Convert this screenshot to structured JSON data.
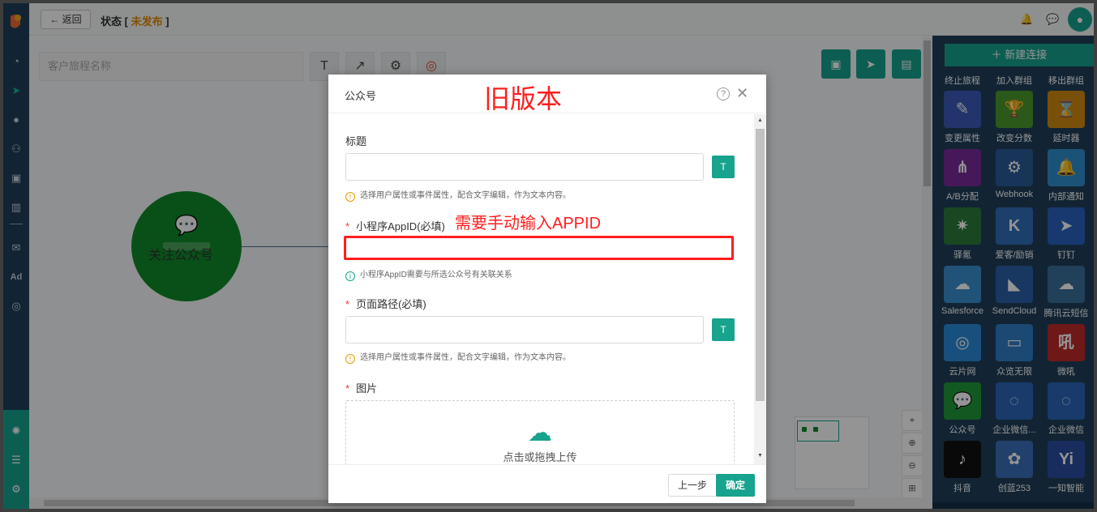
{
  "header": {
    "back_label": "返回",
    "status_prefix": "状态 [",
    "status_value": "未发布",
    "status_suffix": "]"
  },
  "canvas": {
    "name_placeholder": "客户旅程名称",
    "node_label": "关注公众号"
  },
  "right_panel": {
    "new_connection_label": "新建连接",
    "top_captions": [
      "终止旅程",
      "加入群组",
      "移出群组"
    ],
    "tiles": [
      {
        "label": "变更属性",
        "icon": "edit-icon",
        "color": "#3a5bb8",
        "glyph": "✎"
      },
      {
        "label": "改变分数",
        "icon": "trophy-icon",
        "color": "#4a9a2e",
        "glyph": "🏆"
      },
      {
        "label": "延时器",
        "icon": "hourglass-icon",
        "color": "#d08a10",
        "glyph": "⌛"
      },
      {
        "label": "A/B分配",
        "icon": "ab-split-icon",
        "color": "#7a2a9a",
        "glyph": "⋔"
      },
      {
        "label": "Webhook",
        "icon": "webhook-icon",
        "color": "#2a5b9a",
        "glyph": "⚙"
      },
      {
        "label": "内部通知",
        "icon": "bell-icon",
        "color": "#2f8fcf",
        "glyph": "🔔"
      },
      {
        "label": "驿氪",
        "icon": "spider-icon",
        "color": "#2a7a3a",
        "glyph": "✷"
      },
      {
        "label": "爱客/励销",
        "icon": "k-logo-icon",
        "color": "#2f6fb8",
        "glyph": "K"
      },
      {
        "label": "钉钉",
        "icon": "dingtalk-icon",
        "color": "#2a62c0",
        "glyph": "➤"
      },
      {
        "label": "Salesforce",
        "icon": "salesforce-icon",
        "color": "#3a8fd0",
        "glyph": "☁"
      },
      {
        "label": "SendCloud",
        "icon": "sendcloud-icon",
        "color": "#2a5fa8",
        "glyph": "◣"
      },
      {
        "label": "腾讯云短信",
        "icon": "cloud-sms-icon",
        "color": "#3a6f9a",
        "glyph": "☁"
      },
      {
        "label": "云片网",
        "icon": "yunpian-icon",
        "color": "#2a8ad8",
        "glyph": "◎"
      },
      {
        "label": "众览无限",
        "icon": "zhonglan-icon",
        "color": "#2f7fc8",
        "glyph": "▭"
      },
      {
        "label": "微吼",
        "icon": "vhall-icon",
        "color": "#c02a2a",
        "glyph": "吼"
      },
      {
        "label": "公众号",
        "icon": "wechat-icon",
        "color": "#1f9a3a",
        "glyph": "💬"
      },
      {
        "label": "企业微信...",
        "icon": "wecom-icon",
        "color": "#2a66b8",
        "glyph": "◌"
      },
      {
        "label": "企业微信",
        "icon": "wecom-icon-2",
        "color": "#2a66b8",
        "glyph": "◌"
      },
      {
        "label": "抖音",
        "icon": "douyin-icon",
        "color": "#111111",
        "glyph": "♪"
      },
      {
        "label": "创蓝253",
        "icon": "chuanglan-icon",
        "color": "#3a6fb8",
        "glyph": "✿"
      },
      {
        "label": "一知智能",
        "icon": "yiwise-icon",
        "color": "#2a4fa0",
        "glyph": "Yi"
      }
    ]
  },
  "modal": {
    "title": "公众号",
    "annotation_old": "旧版本",
    "field_title_label": "标题",
    "hint_attr": "选择用户属性或事件属性，配合文字编辑，作为文本内容。",
    "field_appid_label": "小程序AppID(必填)",
    "annotation_appid": "需要手动输入APPID",
    "hint_appid": "小程序AppID需要与所选公众号有关联关系",
    "field_path_label": "页面路径(必填)",
    "hint_path": "选择用户属性或事件属性，配合文字编辑，作为文本内容。",
    "field_image_label": "图片",
    "upload_text": "点击或拖拽上传",
    "prev_label": "上一步",
    "ok_label": "确定",
    "required_mark": "*"
  }
}
